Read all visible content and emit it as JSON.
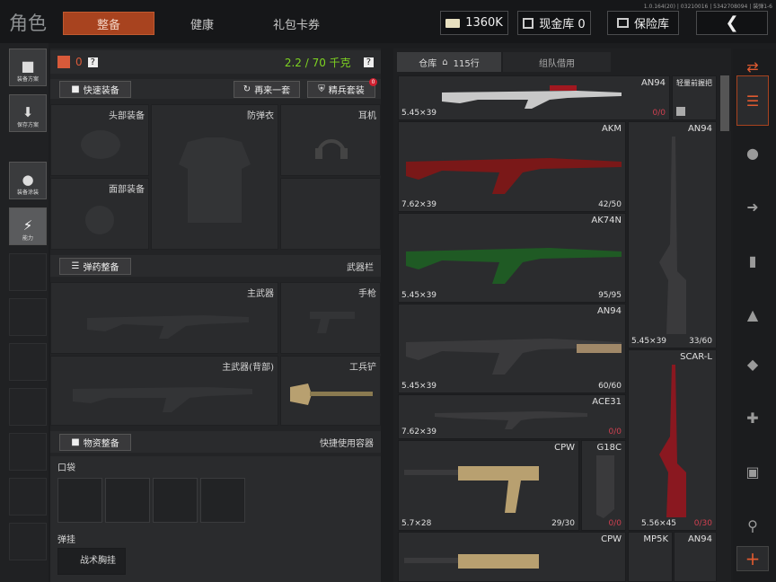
{
  "header": {
    "title": "角色",
    "tabs": [
      "整备",
      "健康",
      "礼包卡券"
    ],
    "currency": "1360K",
    "cash_vault": "现金库 0",
    "safe": "保险库",
    "build": "1.0.164(20) | 03210016 | 5342708094 | 装弹1-6"
  },
  "left_bar": {
    "items": [
      "装备方案",
      "保存方案",
      "装备涂装",
      "能力"
    ]
  },
  "gear": {
    "armor_count": "0",
    "weight": "2.2 / 70 千克",
    "help": "?",
    "quick_equip": "快速装备",
    "again": "再来一套",
    "elite": "精兵套装",
    "elite_badge": "0",
    "slots": {
      "head": "头部装备",
      "armor": "防弹衣",
      "ear": "耳机",
      "face": "面部装备"
    },
    "ammo_btn": "弹药整备",
    "weapon_bar": "武器栏",
    "primary": "主武器",
    "pistol": "手枪",
    "primary_back": "主武器(背部)",
    "shovel": "工兵铲",
    "supply_btn": "物资整备",
    "quick_container": "快捷使用容器",
    "pocket": "口袋",
    "rig": "弹挂",
    "chest_rig": "战术胸挂"
  },
  "stash": {
    "tab1": "仓库",
    "tab1_count": "115行",
    "tab2": "组队借用",
    "items": [
      {
        "name": "AN94",
        "cal": "5.45×39",
        "ammo": "0/0",
        "red": true
      },
      {
        "name": "轻量前握把",
        "cal": "",
        "ammo": "",
        "red": false
      },
      {
        "name": "AKM",
        "cal": "7.62×39",
        "ammo": "42/50",
        "red": false
      },
      {
        "name": "AN94",
        "cal": "5.45×39",
        "ammo": "33/60",
        "red": false
      },
      {
        "name": "AK74N",
        "cal": "5.45×39",
        "ammo": "95/95",
        "red": false
      },
      {
        "name": "AN94",
        "cal": "5.45×39",
        "ammo": "60/60",
        "red": false
      },
      {
        "name": "SCAR-L",
        "cal": "5.56×45",
        "ammo": "0/30",
        "red": true
      },
      {
        "name": "ACE31",
        "cal": "7.62×39",
        "ammo": "0/0",
        "red": true
      },
      {
        "name": "CPW",
        "cal": "5.7×28",
        "ammo": "29/30",
        "red": false
      },
      {
        "name": "G18C",
        "cal": "",
        "ammo": "0/0",
        "red": true
      },
      {
        "name": "CPW",
        "cal": "",
        "ammo": "",
        "red": false
      },
      {
        "name": "MP5K",
        "cal": "",
        "ammo": "",
        "red": false
      },
      {
        "name": "AN94",
        "cal": "",
        "ammo": "",
        "red": false
      }
    ]
  },
  "colors": {
    "accent": "#a8431f",
    "weight": "#7ed321",
    "red": "#d04050"
  }
}
